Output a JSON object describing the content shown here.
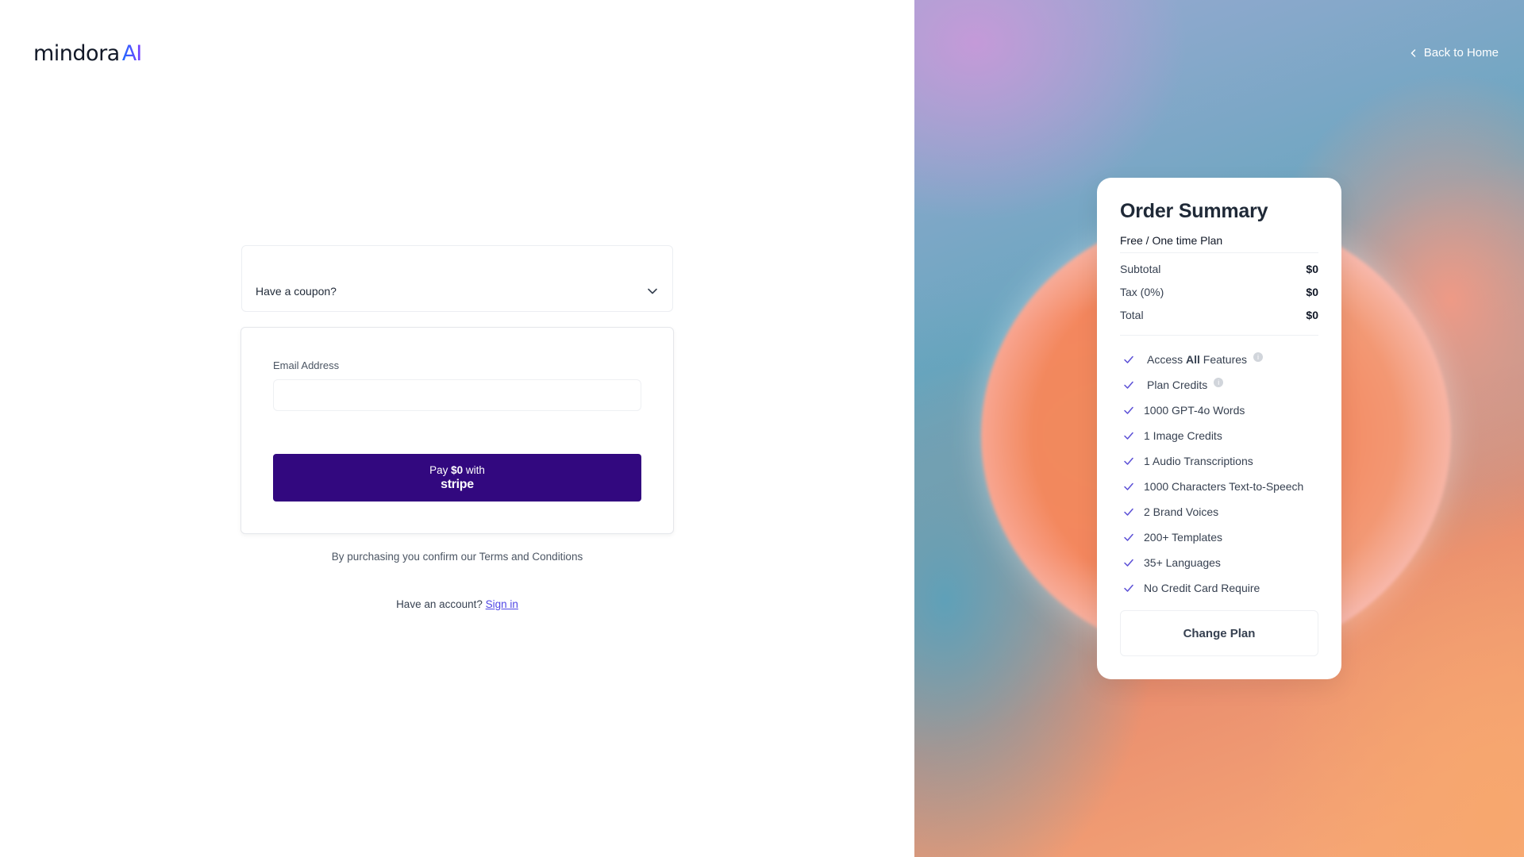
{
  "brand": {
    "name": "mindora",
    "suffix": "AI"
  },
  "coupon": {
    "label": "Have a coupon?"
  },
  "form": {
    "email_label": "Email Address",
    "email_value": "",
    "pay_prefix": "Pay ",
    "pay_amount": "$0",
    "pay_suffix": " with",
    "pay_provider": "stripe"
  },
  "terms": {
    "text": "By purchasing you confirm our Terms and Conditions"
  },
  "account": {
    "prompt": "Have an account?",
    "signin": "Sign in"
  },
  "nav": {
    "back_home": "Back to Home"
  },
  "summary": {
    "title": "Order Summary",
    "plan": "Free / One time Plan",
    "subtotal_label": "Subtotal",
    "subtotal_value": "$0",
    "tax_label": "Tax (0%)",
    "tax_value": "$0",
    "total_label": "Total",
    "total_value": "$0",
    "features": {
      "f0_pre": "Access ",
      "f0_bold": "All",
      "f0_post": " Features",
      "f1": "Plan Credits",
      "f2": "1000 GPT-4o Words",
      "f3": "1 Image Credits",
      "f4": "1 Audio Transcriptions",
      "f5": "1000 Characters Text-to-Speech",
      "f6": "2 Brand Voices",
      "f7": "200+ Templates",
      "f8": "35+ Languages",
      "f9": "No Credit Card Require"
    },
    "change_plan": "Change Plan"
  },
  "colors": {
    "pay_button": "#32087f",
    "link": "#4f46e5",
    "check": "#5b4fd6",
    "logo_gradient_start": "#1f6bff",
    "logo_gradient_end": "#7a3cff"
  },
  "icons": {
    "coupon_toggle": "chevron-down-icon",
    "back": "chevron-left-icon",
    "feature": "check-icon",
    "info": "info-icon"
  }
}
